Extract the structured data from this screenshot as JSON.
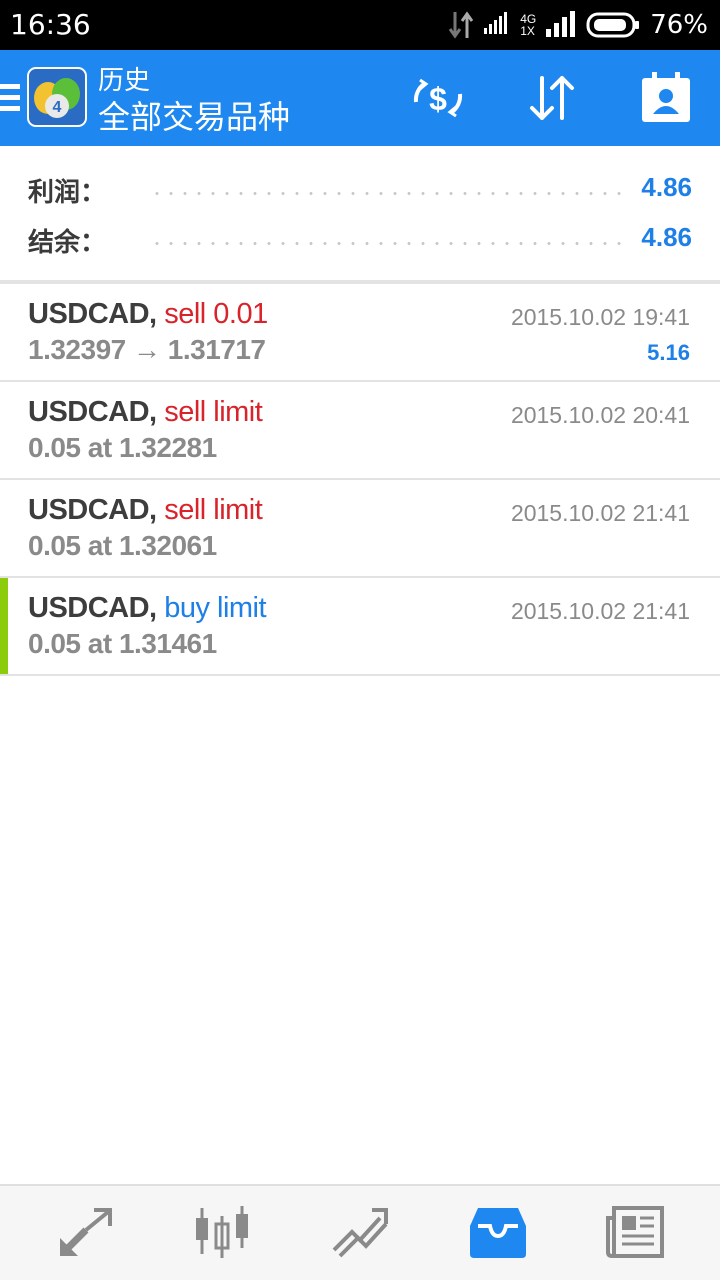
{
  "status_bar": {
    "time": "16:36",
    "network_top": "4G",
    "network_bottom": "1X",
    "battery": "76%"
  },
  "app_bar": {
    "title_small": "历史",
    "title_big": "全部交易品种",
    "icons": [
      "menu-icon",
      "metatrader-logo-icon",
      "currency-exchange-icon",
      "sort-icon",
      "contacts-icon"
    ],
    "accent_color": "#1e88f0"
  },
  "summary": {
    "profit_label": "利润：",
    "profit_value": "4.86",
    "balance_label": "结余：",
    "balance_value": "4.86"
  },
  "orders": [
    {
      "symbol": "USDCAD,",
      "action": "sell 0.01",
      "type": "sell",
      "detail": "1.32397 → 1.31717",
      "date": "2015.10.02 19:41",
      "profit": "5.16"
    },
    {
      "symbol": "USDCAD,",
      "action": "sell limit",
      "type": "sell",
      "detail": "0.05 at 1.32281",
      "date": "2015.10.02 20:41"
    },
    {
      "symbol": "USDCAD,",
      "action": "sell limit",
      "type": "sell",
      "detail": "0.05 at 1.32061",
      "date": "2015.10.02 21:41"
    },
    {
      "symbol": "USDCAD,",
      "action": "buy limit",
      "type": "buy",
      "detail": "0.05 at 1.31461",
      "date": "2015.10.02 21:41",
      "marker_color": "#8ccc0a"
    }
  ],
  "colors": {
    "sell": "#d9232a",
    "buy": "#1e7fe6",
    "value": "#1e7fe6",
    "active_tab": "#1e88f0",
    "inactive_tab": "#8a8a8a"
  },
  "bottom_nav": {
    "items": [
      "quotes-icon",
      "chart-icon",
      "trade-icon",
      "history-icon",
      "news-icon"
    ],
    "active": "history-icon"
  }
}
